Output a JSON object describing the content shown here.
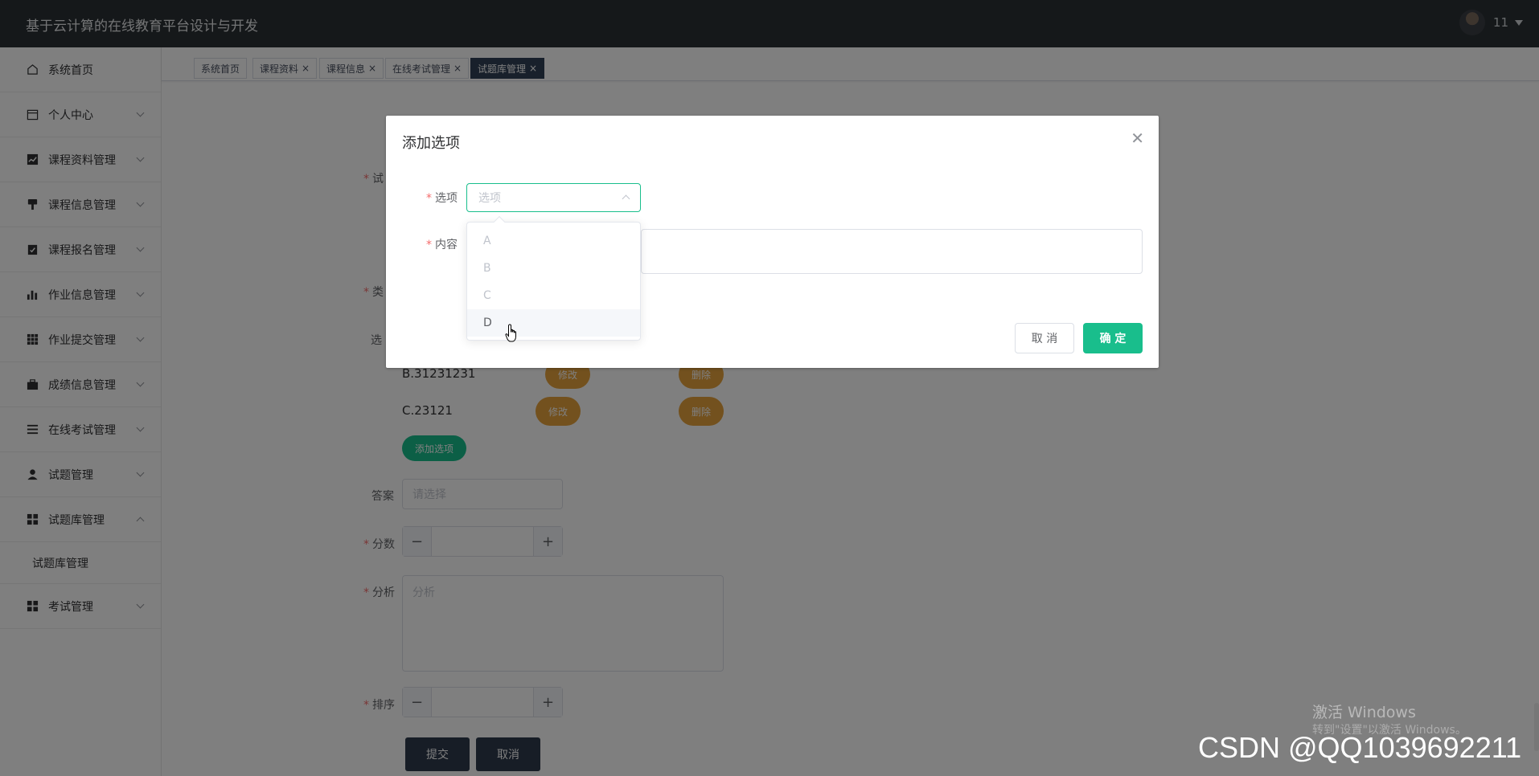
{
  "header": {
    "title": "基于云计算的在线教育平台设计与开发",
    "username": "11"
  },
  "sidebar": {
    "items": [
      {
        "label": "系统首页",
        "icon": "home-icon"
      },
      {
        "label": "个人中心",
        "icon": "calendar-icon"
      },
      {
        "label": "课程资料管理",
        "icon": "chart-icon"
      },
      {
        "label": "课程信息管理",
        "icon": "brush-icon"
      },
      {
        "label": "课程报名管理",
        "icon": "clipboard-icon"
      },
      {
        "label": "作业信息管理",
        "icon": "bar-chart-icon"
      },
      {
        "label": "作业提交管理",
        "icon": "grid-icon"
      },
      {
        "label": "成绩信息管理",
        "icon": "briefcase-icon"
      },
      {
        "label": "在线考试管理",
        "icon": "list-icon"
      },
      {
        "label": "试题管理",
        "icon": "user-icon"
      },
      {
        "label": "试题库管理",
        "icon": "apps-icon"
      },
      {
        "label": "考试管理",
        "icon": "apps-icon"
      }
    ],
    "submenu_label": "试题库管理"
  },
  "tabs": [
    {
      "label": "系统首页"
    },
    {
      "label": "课程资料"
    },
    {
      "label": "课程信息"
    },
    {
      "label": "在线考试管理"
    },
    {
      "label": "试题库管理"
    }
  ],
  "form": {
    "field_question_prefix": "试",
    "field_type_prefix": "类",
    "field_options_prefix": "选",
    "options": [
      {
        "text": "B.31231231",
        "edit": "修改",
        "delete": "删除"
      },
      {
        "text": "C.23121",
        "edit": "修改",
        "delete": "删除"
      }
    ],
    "add_option_label": "添加选项",
    "answer_label": "答案",
    "answer_placeholder": "请选择",
    "score_label": "分数",
    "analysis_label": "分析",
    "analysis_placeholder": "分析",
    "order_label": "排序",
    "submit_label": "提交",
    "cancel_label": "取消"
  },
  "dialog": {
    "title": "添加选项",
    "option_label": "选项",
    "option_placeholder": "选项",
    "content_label": "内容",
    "cancel_label": "取 消",
    "confirm_label": "确 定",
    "dropdown_options": [
      "A",
      "B",
      "C",
      "D"
    ],
    "hovered_option": "D"
  },
  "watermark": {
    "line1": "激活 Windows",
    "line2": "转到\"设置\"以激活 Windows。",
    "csdn": "CSDN @QQ1039692211"
  },
  "colors": {
    "accent": "#19be8c",
    "warning": "#e6a23c",
    "header_bg": "#2b3034"
  }
}
